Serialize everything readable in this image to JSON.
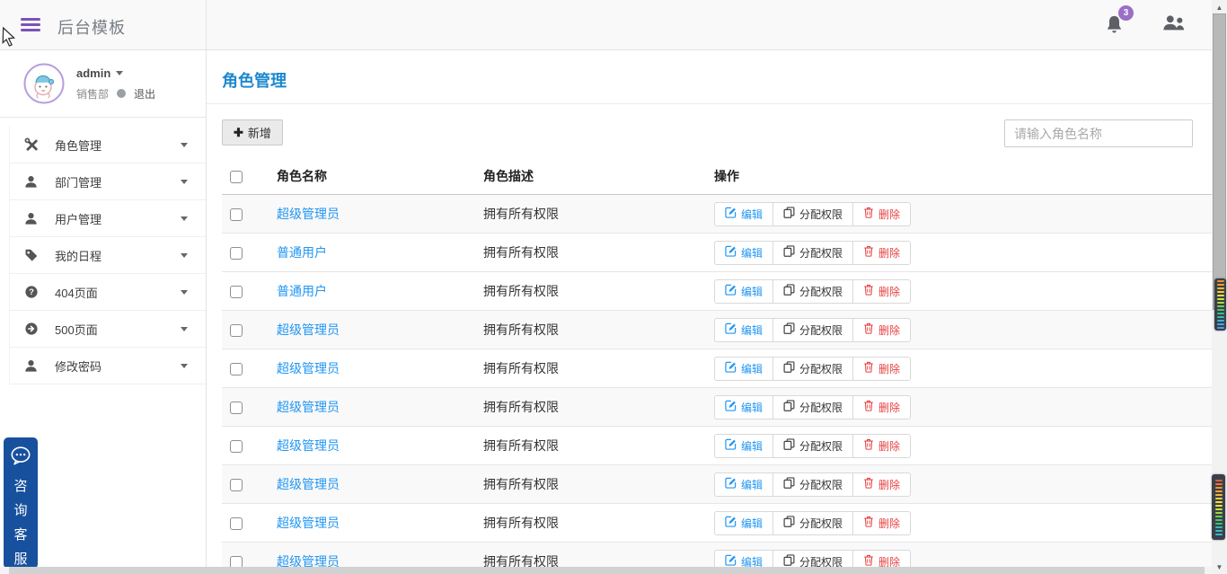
{
  "topbar": {
    "title": "后台模板",
    "notification_count": "3"
  },
  "profile": {
    "username": "admin",
    "department": "销售部",
    "logout_label": "退出"
  },
  "sidebar": {
    "items": [
      {
        "key": "role-management",
        "icon": "tools-icon",
        "label": "角色管理"
      },
      {
        "key": "department-management",
        "icon": "user-icon",
        "label": "部门管理"
      },
      {
        "key": "user-management",
        "icon": "user-icon",
        "label": "用户管理"
      },
      {
        "key": "my-schedule",
        "icon": "tag-icon",
        "label": "我的日程"
      },
      {
        "key": "page-404",
        "icon": "question-circle-icon",
        "label": "404页面"
      },
      {
        "key": "page-500",
        "icon": "arrow-circle-icon",
        "label": "500页面"
      },
      {
        "key": "change-password",
        "icon": "user-icon",
        "label": "修改密码"
      }
    ]
  },
  "main": {
    "page_title": "角色管理",
    "add_button_label": "新增",
    "search_placeholder": "请输入角色名称",
    "table": {
      "headers": {
        "name": "角色名称",
        "desc": "角色描述",
        "actions": "操作"
      },
      "action_labels": {
        "edit": "编辑",
        "assign": "分配权限",
        "delete": "删除"
      },
      "rows": [
        {
          "name": "超级管理员",
          "desc": "拥有所有权限"
        },
        {
          "name": "普通用户",
          "desc": "拥有所有权限"
        },
        {
          "name": "普通用户",
          "desc": "拥有所有权限"
        },
        {
          "name": "超级管理员",
          "desc": "拥有所有权限"
        },
        {
          "name": "超级管理员",
          "desc": "拥有所有权限"
        },
        {
          "name": "超级管理员",
          "desc": "拥有所有权限"
        },
        {
          "name": "超级管理员",
          "desc": "拥有所有权限"
        },
        {
          "name": "超级管理员",
          "desc": "拥有所有权限"
        },
        {
          "name": "超级管理员",
          "desc": "拥有所有权限"
        },
        {
          "name": "超级管理员",
          "desc": "拥有所有权限"
        }
      ]
    }
  },
  "service_widget": {
    "label": "咨询客服"
  },
  "colors": {
    "accent_purple": "#7a52b8",
    "badge_purple": "#9b6fc6",
    "page_title_blue": "#1e88cf",
    "link_blue": "#2196f3",
    "delete_red": "#e64242",
    "service_blue": "#17519e"
  },
  "edge_widgets": {
    "palette_top": [
      "#ef8d2f",
      "#f0a32f",
      "#f2b92f",
      "#f4cf30",
      "#f0df38",
      "#d6e23c",
      "#aadb3f",
      "#7bd04b",
      "#4fc465",
      "#35bd8d",
      "#2fc0b0",
      "#35b6d6",
      "#3fa8e8",
      "#4a9bef"
    ],
    "palette_bottom": [
      "#e4573f",
      "#ea7436",
      "#ef8d2f",
      "#f0a32f",
      "#f2b92f",
      "#f4cf30",
      "#f0df38",
      "#e4e43a",
      "#c8e03c",
      "#a0d642",
      "#74cc4e",
      "#4ec463",
      "#38bd85",
      "#2fbfa4",
      "#2fc0bd",
      "#35b6d6"
    ]
  }
}
